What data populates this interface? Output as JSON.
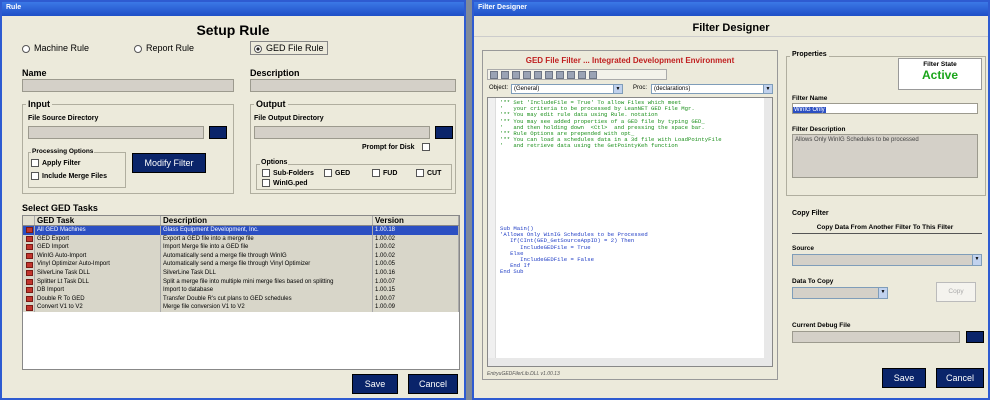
{
  "left": {
    "title_bar": "Rule",
    "header": "Setup Rule",
    "rule_types": [
      {
        "label": "Machine Rule",
        "selected": false
      },
      {
        "label": "Report Rule",
        "selected": false
      },
      {
        "label": "GED File Rule",
        "selected": true
      }
    ],
    "name_label": "Name",
    "description_label": "Description",
    "input": {
      "title": "Input",
      "file_source_label": "File Source Directory",
      "processing_title": "Processing Options",
      "apply_filter": "Apply Filter",
      "include_merge": "Include Merge Files",
      "modify_filter": "Modify Filter"
    },
    "output": {
      "title": "Output",
      "file_output_label": "File Output Directory",
      "prompt_disk": "Prompt for Disk",
      "options_title": "Options",
      "options": [
        "Sub-Folders",
        "GED",
        "FUD",
        "CUT",
        "WinIG.ped"
      ]
    },
    "tasks_title": "Select GED Tasks",
    "columns": [
      "GED Task",
      "Description",
      "Version"
    ],
    "rows": [
      {
        "task": "All GED Machines",
        "description": "Glass Equipment Development, Inc.",
        "version": "1.00.18",
        "selected": true
      },
      {
        "task": "GED Export",
        "description": "Export a GED file into a merge file",
        "version": "1.00.02",
        "selected": false
      },
      {
        "task": "GED Import",
        "description": "Import Merge file into a GED file",
        "version": "1.00.02",
        "selected": false
      },
      {
        "task": "WinIG Auto-Import",
        "description": "Automatically send a merge file through WinIG",
        "version": "1.00.02",
        "selected": false
      },
      {
        "task": "Vinyl Optimizer Auto-Import",
        "description": "Automatically send a merge file through Vinyl Optimizer",
        "version": "1.00.05",
        "selected": false
      },
      {
        "task": "SilverLine Task DLL",
        "description": "SilverLine Task DLL",
        "version": "1.00.16",
        "selected": false
      },
      {
        "task": "Splitter Lt Task DLL",
        "description": "Split a merge file into multiple mini merge files based on splitting",
        "version": "1.00.07",
        "selected": false
      },
      {
        "task": "DB Import",
        "description": "Import to database",
        "version": "1.00.15",
        "selected": false
      },
      {
        "task": "Double R To GED",
        "description": "Transfer Double R's cut plans to GED schedules",
        "version": "1.00.07",
        "selected": false
      },
      {
        "task": "Convert V1 to V2",
        "description": "Merge file conversion V1 to V2",
        "version": "1.00.09",
        "selected": false
      }
    ],
    "save": "Save",
    "cancel": "Cancel"
  },
  "right": {
    "title_bar": "Filter Designer",
    "header": "Filter Designer",
    "ide_title": "GED File Filter ... Integrated Development Environment",
    "object_label": "Object:",
    "object_value": "(General)",
    "proc_label": "Proc:",
    "proc_value": "(declarations)",
    "comments": [
      "'** Set 'IncludeFile = True' To allow Files which meet",
      "'   your criteria to be processed by LeanNET GED File Mgr.",
      "'** You may edit rule data using Rule. notation",
      "'** You may see added properties of a GED file by typing GED_",
      "'   and then holding down  <Ctl>  and pressing the space bar.",
      "'** Rule Options are prepended with opt_",
      "'** You can load a schedules data in a 3d file with LoadPointyFile",
      "'   and retrieve data using the GetPointyKeh function"
    ],
    "code": [
      "Sub Main()",
      "'Allows Only WinIG Schedules to be Processed",
      "   If(CInt(GED_GetSourceAppID) = 2) Then",
      "      IncludeGEDFile = True",
      "   Else",
      "      IncludeGEDFile = False",
      "   End If",
      "End Sub"
    ],
    "status": "EntryuGEDFilerLib.DLL v1.00.13",
    "properties_title": "Properties",
    "filter_state_label": "Filter State",
    "filter_state": "Active",
    "filter_name_label": "Filter Name",
    "filter_name": "WinIG Only",
    "filter_desc_label": "Filter Description",
    "filter_desc": "Allows Only WinIG Schedules to be processed",
    "copy_filter_title": "Copy Filter",
    "copy_data_text": "Copy Data From Another Filter To This Filter",
    "source_label": "Source",
    "data_to_copy_label": "Data To Copy",
    "copy_button": "Copy",
    "debug_label": "Current Debug File",
    "save": "Save",
    "cancel": "Cancel",
    "colors": {
      "active": "#1aa51a",
      "selection": "#2b4fc2",
      "titlebar": "#1e4fc7"
    }
  }
}
